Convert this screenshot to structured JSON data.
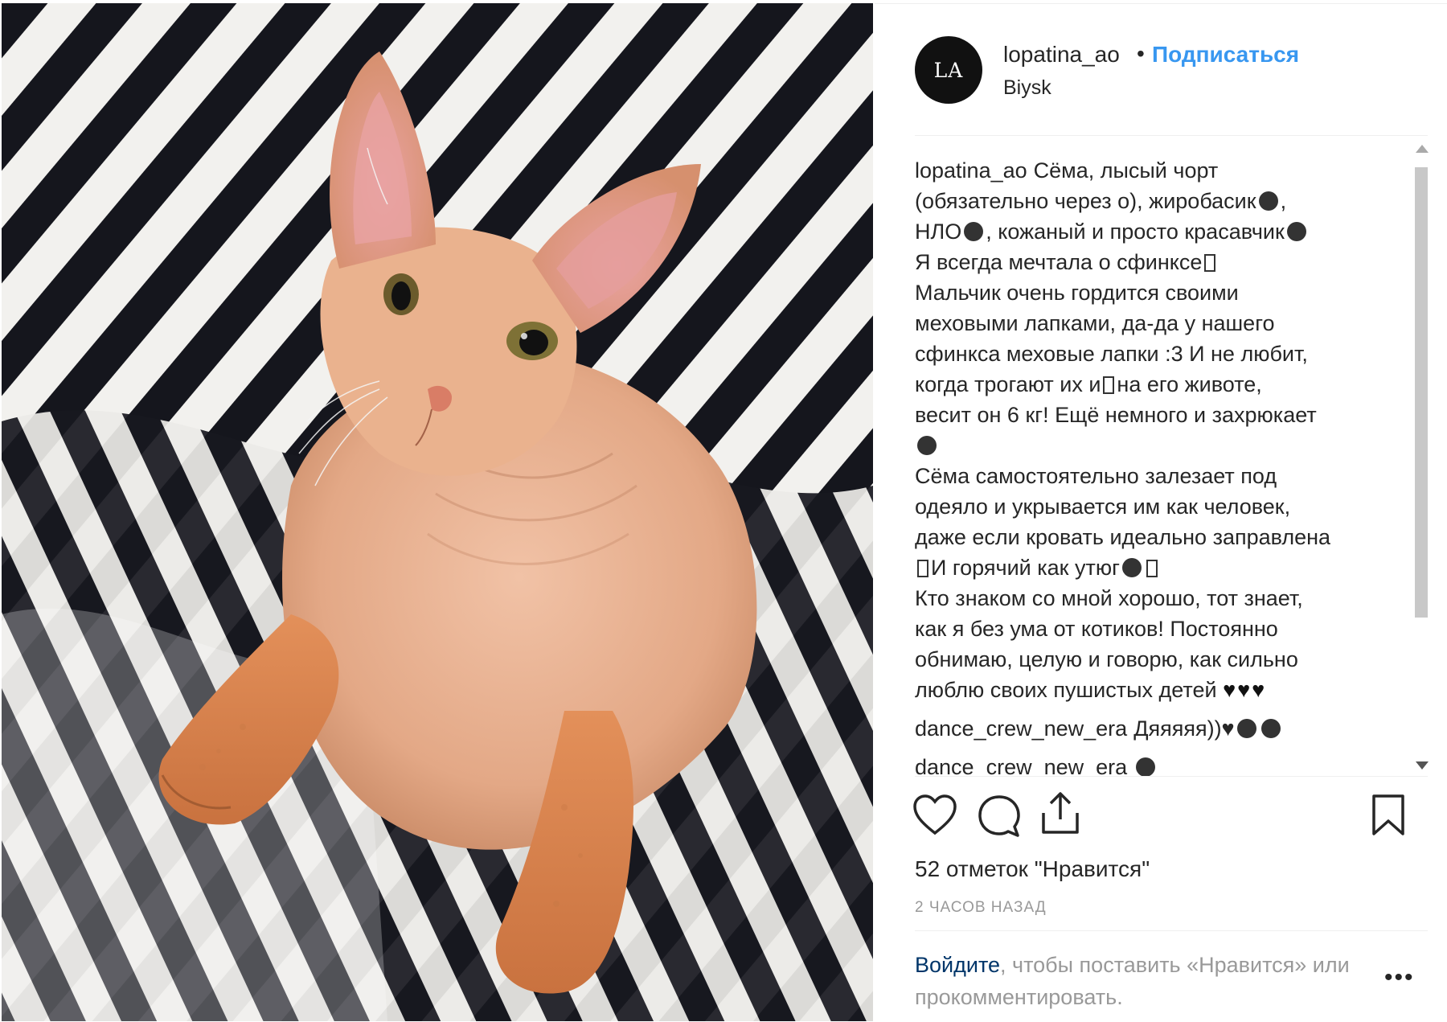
{
  "post": {
    "username": "lopatina_ao",
    "separator": "•",
    "follow_label": "Подписаться",
    "location": "Biysk",
    "avatar_initials": "LA"
  },
  "caption": {
    "username": "lopatina_ao",
    "lines": [
      "Сёма, лысый чорт",
      "(обязательно через о), жиробасик",
      "НЛО",
      ", кожаный и просто красавчик",
      "Я всегда мечтала о сфинксе",
      "Мальчик очень гордится своими",
      "меховыми лапками, да-да у нашего",
      "сфинкса меховые лапки :3 И не любит,",
      "когда трогают их и",
      "на его животе,",
      "весит он 6 кг! Ещё немного и захрюкает",
      "Сёма самостоятельно залезает под",
      "одеяло и укрывается им как человек,",
      "даже если кровать идеально заправлена",
      "И горячий как утюг",
      "Кто знаком со мной хорошо, тот знает,",
      "как я без ума от котиков! Постоянно",
      "обнимаю, целую и говорю, как сильно",
      "люблю своих пушистых детей",
      "♥♥♥"
    ]
  },
  "comments": [
    {
      "username": "dance_crew_new_era",
      "text": "Дяяяяя))♥",
      "icons": [
        "smile-emoji-icon",
        "fire-emoji-icon"
      ]
    },
    {
      "username": "dance_crew_new_era",
      "text": "",
      "icons": [
        "laugh-emoji-icon"
      ]
    }
  ],
  "actions": {
    "icons": [
      "heart-icon",
      "comment-icon",
      "share-icon",
      "bookmark-icon"
    ]
  },
  "likes_text": "52 отметок \"Нравится\"",
  "time_text": "2 ЧАСОВ НАЗАД",
  "login_prompt": {
    "link": "Войдите",
    "text": ", чтобы поставить «Нравится» или прокомментировать."
  },
  "more_label": "•••",
  "colors": {
    "accent": "#3897f0",
    "text": "#262626",
    "muted": "#999999"
  }
}
